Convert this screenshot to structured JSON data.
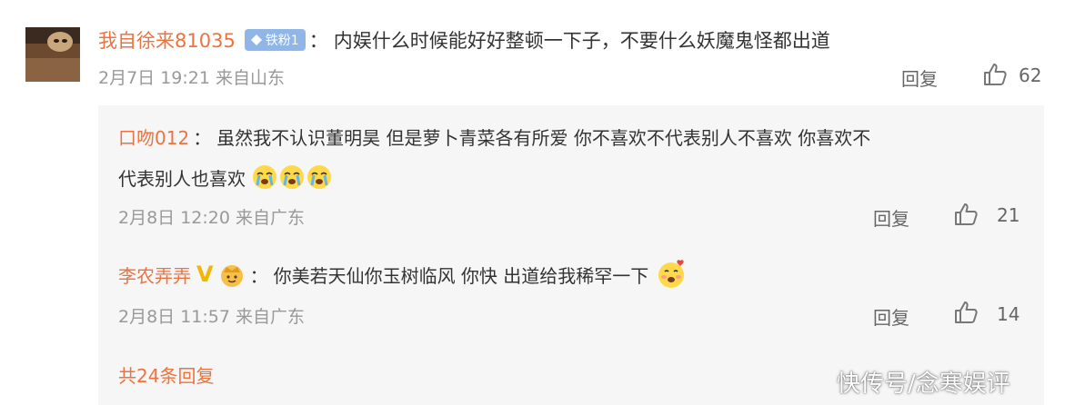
{
  "main_comment": {
    "username": "我自徐来81035",
    "fan_badge": "铁粉1",
    "colon": "：",
    "text": "内娱什么时候能好好整顿一下子，不要什么妖魔鬼怪都出道",
    "meta": "2月7日 19:21 来自山东",
    "reply_label": "回复",
    "likes": "62"
  },
  "replies": [
    {
      "username": "口吻012",
      "colon": "：",
      "text_line1": "虽然我不认识董明昊 但是萝卜青菜各有所爱 你不喜欢不代表别人不喜欢 你喜欢不",
      "text_line2": "代表别人也喜欢",
      "emoji_icons": [
        "crying-face-icon",
        "crying-face-icon",
        "crying-face-icon"
      ],
      "meta": "2月8日 12:20 来自广东",
      "reply_label": "回复",
      "likes": "21"
    },
    {
      "username": "李农弄弄",
      "vip_badge": "V",
      "colon": "：",
      "text": "你美若天仙你玉树临风 你快 出道给我稀罕一下",
      "emoji_icon": "love-struck-face-icon",
      "meta": "2月8日 11:57 来自广东",
      "reply_label": "回复",
      "likes": "14"
    }
  ],
  "total_replies_link": "共24条回复",
  "watermark": "快传号/念寒娱评",
  "colors": {
    "username": "#eb7340",
    "text": "#333333",
    "meta": "#999999",
    "reply_panel_bg": "#f6f6f6",
    "fan_badge_bg": "#8fb6e6"
  }
}
